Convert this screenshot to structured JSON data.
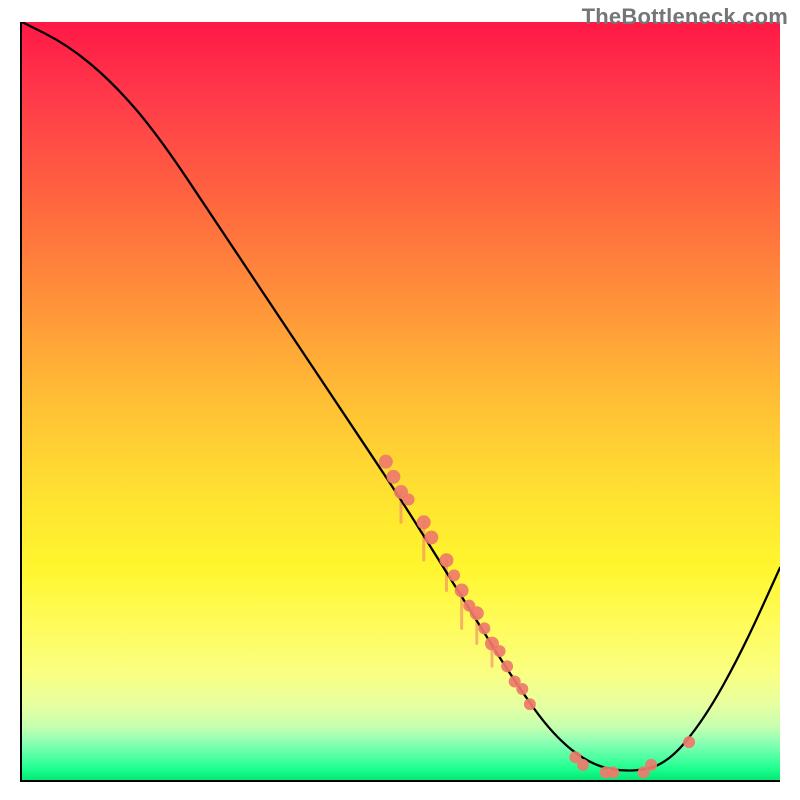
{
  "watermark": "TheBottleneck.com",
  "chart_data": {
    "type": "line",
    "title": "",
    "xlabel": "",
    "ylabel": "",
    "xlim": [
      0,
      100
    ],
    "ylim": [
      0,
      100
    ],
    "background_gradient": {
      "stops": [
        {
          "pos": 0,
          "color": "#ff1846"
        },
        {
          "pos": 0.25,
          "color": "#ff6a3e"
        },
        {
          "pos": 0.5,
          "color": "#ffbf35"
        },
        {
          "pos": 0.72,
          "color": "#fff62e"
        },
        {
          "pos": 0.9,
          "color": "#e7ffa0"
        },
        {
          "pos": 1.0,
          "color": "#06e874"
        }
      ]
    },
    "curve": [
      {
        "x": 0,
        "y": 100
      },
      {
        "x": 6,
        "y": 97
      },
      {
        "x": 12,
        "y": 92
      },
      {
        "x": 18,
        "y": 85
      },
      {
        "x": 26,
        "y": 73
      },
      {
        "x": 34,
        "y": 61
      },
      {
        "x": 42,
        "y": 49
      },
      {
        "x": 50,
        "y": 37
      },
      {
        "x": 55,
        "y": 29
      },
      {
        "x": 60,
        "y": 21
      },
      {
        "x": 65,
        "y": 13
      },
      {
        "x": 70,
        "y": 6
      },
      {
        "x": 75,
        "y": 2
      },
      {
        "x": 80,
        "y": 1
      },
      {
        "x": 85,
        "y": 2
      },
      {
        "x": 90,
        "y": 8
      },
      {
        "x": 95,
        "y": 17
      },
      {
        "x": 100,
        "y": 28
      }
    ],
    "scatter_points": [
      {
        "x": 48,
        "y": 42,
        "r": 7
      },
      {
        "x": 49,
        "y": 40,
        "r": 7
      },
      {
        "x": 50,
        "y": 38,
        "r": 7
      },
      {
        "x": 51,
        "y": 37,
        "r": 6
      },
      {
        "x": 53,
        "y": 34,
        "r": 7
      },
      {
        "x": 54,
        "y": 32,
        "r": 7
      },
      {
        "x": 56,
        "y": 29,
        "r": 7
      },
      {
        "x": 57,
        "y": 27,
        "r": 6
      },
      {
        "x": 58,
        "y": 25,
        "r": 7
      },
      {
        "x": 59,
        "y": 23,
        "r": 6
      },
      {
        "x": 60,
        "y": 22,
        "r": 7
      },
      {
        "x": 61,
        "y": 20,
        "r": 6
      },
      {
        "x": 62,
        "y": 18,
        "r": 7
      },
      {
        "x": 63,
        "y": 17,
        "r": 6
      },
      {
        "x": 64,
        "y": 15,
        "r": 6
      },
      {
        "x": 65,
        "y": 13,
        "r": 6
      },
      {
        "x": 66,
        "y": 12,
        "r": 6
      },
      {
        "x": 67,
        "y": 10,
        "r": 6
      },
      {
        "x": 73,
        "y": 3,
        "r": 6
      },
      {
        "x": 74,
        "y": 2,
        "r": 6
      },
      {
        "x": 77,
        "y": 1,
        "r": 6
      },
      {
        "x": 78,
        "y": 1,
        "r": 6
      },
      {
        "x": 82,
        "y": 1,
        "r": 6
      },
      {
        "x": 83,
        "y": 2,
        "r": 6
      },
      {
        "x": 88,
        "y": 5,
        "r": 6
      }
    ],
    "drips": [
      {
        "x": 50,
        "y_top": 38,
        "len": 4
      },
      {
        "x": 53,
        "y_top": 34,
        "len": 5
      },
      {
        "x": 56,
        "y_top": 29,
        "len": 4
      },
      {
        "x": 58,
        "y_top": 25,
        "len": 5
      },
      {
        "x": 60,
        "y_top": 22,
        "len": 4
      },
      {
        "x": 62,
        "y_top": 18,
        "len": 3
      }
    ]
  }
}
